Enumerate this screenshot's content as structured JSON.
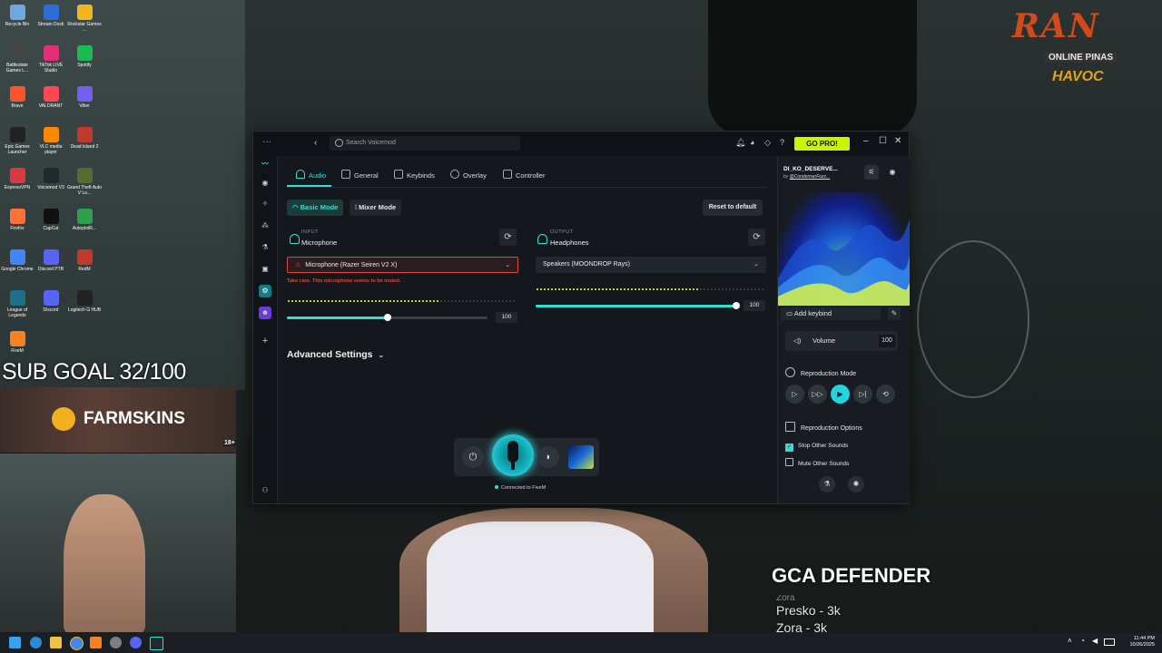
{
  "desktop_icons": [
    {
      "label": "Recycle Bin",
      "color": "#6fa8dc"
    },
    {
      "label": "Stream Dock",
      "color": "#2b6fd6"
    },
    {
      "label": "Rockstar Games ...",
      "color": "#f0b81e"
    },
    {
      "label": "Battlestate Games L...",
      "color": "#444444"
    },
    {
      "label": "TikTok LIVE Studio",
      "color": "#e0307a"
    },
    {
      "label": "Spotify",
      "color": "#1db954"
    },
    {
      "label": "Brave",
      "color": "#fb542b"
    },
    {
      "label": "VALORANT",
      "color": "#ff4655"
    },
    {
      "label": "Viber",
      "color": "#7360f2"
    },
    {
      "label": "Epic Games Launcher",
      "color": "#222222"
    },
    {
      "label": "VLC media player",
      "color": "#ff8800"
    },
    {
      "label": "Dead Island 2",
      "color": "#c0392b"
    },
    {
      "label": "ExpressVPN",
      "color": "#da3940"
    },
    {
      "label": "Voicemod V3",
      "color": "#1f2a2e"
    },
    {
      "label": "Grand Theft Auto V Le...",
      "color": "#556b2f"
    },
    {
      "label": "Firefox",
      "color": "#ff7139"
    },
    {
      "label": "CapCut",
      "color": "#111111"
    },
    {
      "label": "AutoplotR...",
      "color": "#2e9e4f"
    },
    {
      "label": "Google Chrome",
      "color": "#4285f4"
    },
    {
      "label": "Discord PTB",
      "color": "#5865f2"
    },
    {
      "label": "RedM",
      "color": "#c0392b"
    },
    {
      "label": "League of Legends",
      "color": "#1e6f8a"
    },
    {
      "label": "Discord",
      "color": "#5865f2"
    },
    {
      "label": "Logitech G HUB",
      "color": "#222222"
    },
    {
      "label": "FiveM",
      "color": "#f58220"
    }
  ],
  "overlay": {
    "sub_goal": "SUB GOAL 32/100",
    "sponsor": "FARMSKINS",
    "age_badge": "18+",
    "logo_main": "RAN",
    "logo_sub": "ONLINE PINAS",
    "logo_havoc": "HAVOC",
    "defender": "GCA DEFENDER",
    "credits": [
      "Zora",
      "Presko - 3k",
      "Zora - 3k"
    ]
  },
  "taskbar": {
    "time": "11:44 PM",
    "date": "10/26/2025"
  },
  "voicemod": {
    "search_placeholder": "Search Voicemod",
    "go_pro": "GO PRO!",
    "tabs": [
      "Audio",
      "General",
      "Keybinds",
      "Overlay",
      "Controller"
    ],
    "active_tab": "Audio",
    "modes": {
      "basic": "Basic Mode",
      "mixer": "Mixer Mode"
    },
    "reset": "Reset to default",
    "input": {
      "label": "INPUT",
      "value": "Microphone",
      "device": "Microphone (Razer Seiren V2 X)",
      "error": "Take care. This microphone seems to be muted.",
      "level": 100,
      "slider_fraction": 0.5
    },
    "output": {
      "label": "OUTPUT",
      "value": "Headphones",
      "device": "Speakers (MOONDROP Rays)",
      "level": 100,
      "slider_fraction": 1.0
    },
    "advanced": "Advanced Settings",
    "connected": "Connected to FiveM",
    "voice": {
      "name": "DI_KO_DESERVE...",
      "by_prefix": "by ",
      "author": "@CondenserFuzz..."
    },
    "add_keybind": "Add keybind",
    "volume_label": "Volume",
    "volume_value": "100",
    "reproduction_mode": "Reproduction Mode",
    "reproduction_options": "Reproduction Options",
    "options": [
      {
        "label": "Stop Other Sounds",
        "checked": true
      },
      {
        "label": "Mute Other Sounds",
        "checked": false
      }
    ],
    "colors": {
      "accent": "#32e0d3",
      "error": "#e0483a",
      "gopro": "#c8f500"
    }
  }
}
